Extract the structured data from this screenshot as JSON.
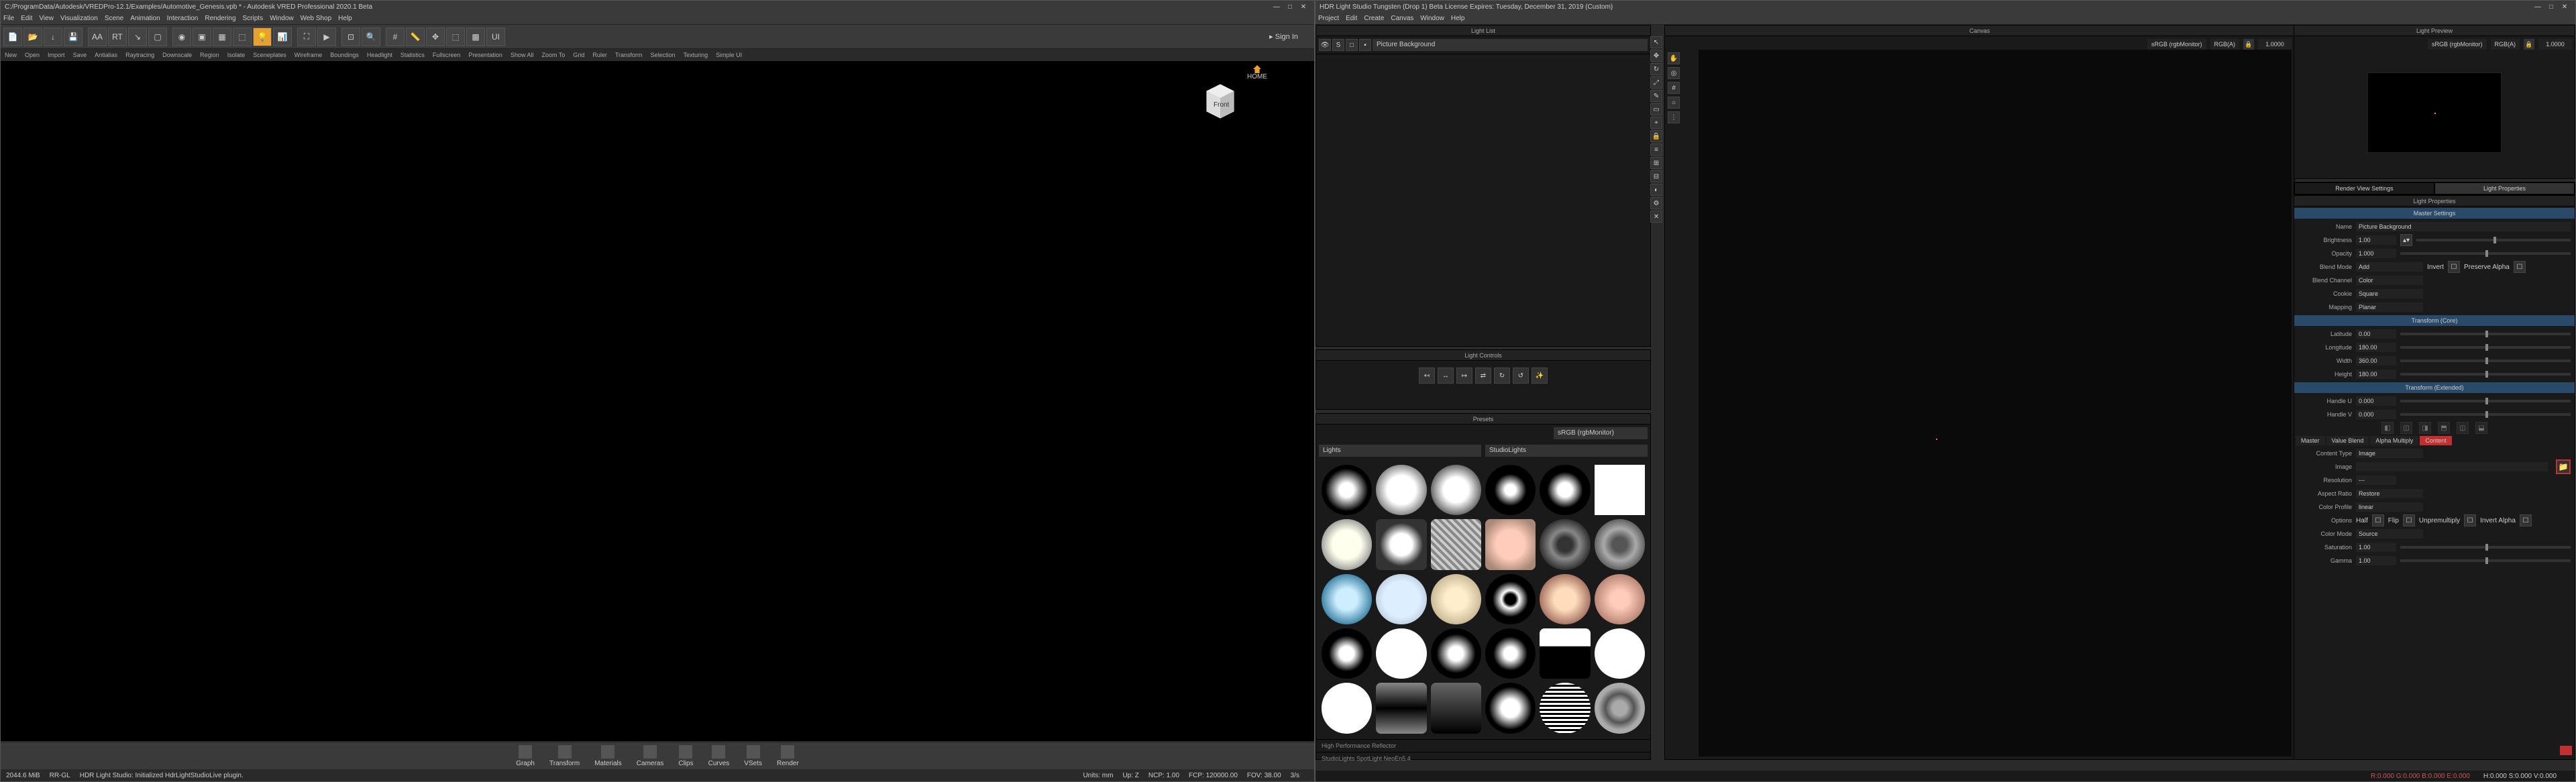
{
  "vred": {
    "title": "C:/ProgramData/Autodesk/VREDPro-12.1/Examples/Automotive_Genesis.vpb * - Autodesk VRED Professional 2020.1 Beta",
    "menus": [
      "File",
      "Edit",
      "View",
      "Visualization",
      "Scene",
      "Animation",
      "Interaction",
      "Rendering",
      "Scripts",
      "Window",
      "Web Shop",
      "Help"
    ],
    "signin": "▸ Sign In",
    "second": [
      "New",
      "Open",
      "Import",
      "Save",
      "Antialias",
      "Raytracing",
      "Downscale",
      "Region",
      "Isolate",
      "Sceneplates",
      "Wireframe",
      "Boundings",
      "Headlight",
      "Statistics",
      "Fullscreen",
      "Presentation",
      "Show All",
      "Zoom To",
      "Grid",
      "Ruler",
      "Transform",
      "Selection",
      "Texturing",
      "Simple UI"
    ],
    "cube_face": "Front",
    "home": "HOME",
    "bottom": [
      "Graph",
      "Transform",
      "Materials",
      "Cameras",
      "Clips",
      "Curves",
      "VSets",
      "Render"
    ],
    "status": {
      "mem": "2044.6 MiB",
      "renderer": "RR-GL",
      "msg": "HDR Light Studio: Initialized HdrLightStudioLive plugin.",
      "units": "Units: mm",
      "up": "Up: Z",
      "ncp": "NCP: 1.00",
      "fcp": "FCP: 120000.00",
      "fov": "FOV: 38.00",
      "fps": "3/s"
    }
  },
  "hdr": {
    "title": "HDR Light Studio Tungsten (Drop 1) Beta License Expires: Tuesday, December 31, 2019  (Custom)",
    "menus": [
      "Project",
      "Edit",
      "Create",
      "Canvas",
      "Window",
      "Help"
    ],
    "panels": {
      "lightlist": "Light List",
      "lightctrl": "Light Controls",
      "presets": "Presets",
      "canvas": "Canvas",
      "preview": "Light Preview"
    },
    "light_name": "Picture Background",
    "canvas_cs": "sRGB (rgbMonitor)",
    "canvas_fmt": "RGB(A)",
    "canvas_exp": "1.0000",
    "preview_cs": "sRGB (rgbMonitor)",
    "preview_fmt": "RGB(A)",
    "preview_exp": "1.0000",
    "presets_cs": "sRGB (rgbMonitor)",
    "presets_cat1": "Lights",
    "presets_cat2": "StudioLights",
    "presets_sel": "High Performance Reflector",
    "presets_path": "StudioLights SpotLight NeoEn5.4",
    "rvtabs": [
      "Render View Settings",
      "Light Properties"
    ],
    "proptitle": "Light Properties",
    "sections": {
      "master": "Master Settings",
      "tcore": "Transform (Core)",
      "text": "Transform (Extended)"
    },
    "rows": {
      "name_l": "Name",
      "name_v": "Picture Background",
      "bright_l": "Brightness",
      "bright_v": "1.00",
      "opac_l": "Opacity",
      "opac_v": "1.000",
      "blend_l": "Blend Mode",
      "blend_v": "Add",
      "invert": "Invert",
      "preservea": "Preserve Alpha",
      "bchan_l": "Blend Channel",
      "bchan_v": "Color",
      "cookie_l": "Cookie",
      "cookie_v": "Square",
      "map_l": "Mapping",
      "map_v": "Planar",
      "lat_l": "Latitude",
      "lat_v": "0.00",
      "lon_l": "Longitude",
      "lon_v": "180.00",
      "wid_l": "Width",
      "wid_v": "360.00",
      "hgt_l": "Height",
      "hgt_v": "180.00",
      "hu_l": "Handle U",
      "hu_v": "0.000",
      "hv_l": "Handle V",
      "hv_v": "0.000"
    },
    "ctabs": [
      "Master",
      "Value Blend",
      "Alpha Multiply",
      "Content"
    ],
    "content": {
      "ctype_l": "Content Type",
      "ctype_v": "Image",
      "img_l": "Image",
      "res_l": "Resolution",
      "res_v": "---",
      "ar_l": "Aspect Ratio",
      "ar_v": "Restore",
      "cp_l": "Color Profile",
      "cp_v": "linear",
      "opt_l": "Options",
      "opt_half": "Half",
      "opt_flip": "Flip",
      "opt_un": "Unpremultiply",
      "opt_ia": "Invert Alpha",
      "cm_l": "Color Mode",
      "cm_v": "Source",
      "sat_l": "Saturation",
      "sat_v": "1.00",
      "gam_l": "Gamma",
      "gam_v": "1.00"
    },
    "status": {
      "rgb": "R:0.000 G:0.000 B:0.000 E:0.000",
      "hsv": "H:0.000 S:0.000 V:0.000"
    }
  }
}
